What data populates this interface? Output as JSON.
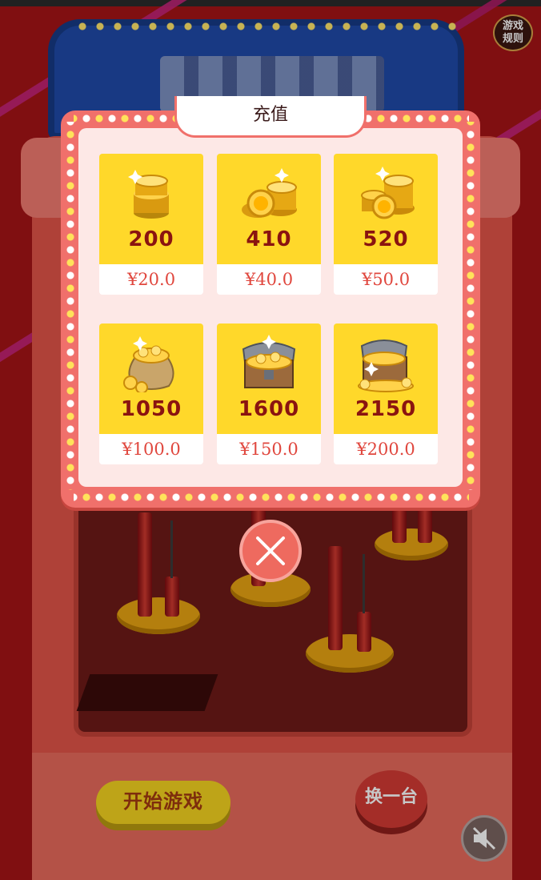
{
  "modal": {
    "title": "充值",
    "packages": [
      {
        "amount": "200",
        "price": "¥20.0",
        "icon": "coin-stack-small-icon"
      },
      {
        "amount": "410",
        "price": "¥40.0",
        "icon": "coin-stack-medium-icon"
      },
      {
        "amount": "520",
        "price": "¥50.0",
        "icon": "coin-stack-large-icon"
      },
      {
        "amount": "1050",
        "price": "¥100.0",
        "icon": "coin-bag-icon"
      },
      {
        "amount": "1600",
        "price": "¥150.0",
        "icon": "treasure-chest-icon"
      },
      {
        "amount": "2150",
        "price": "¥200.0",
        "icon": "treasure-chest-overflow-icon"
      }
    ],
    "close_icon": "close-icon"
  },
  "game": {
    "rules_label": "游戏规则",
    "start_label": "开始游戏",
    "swap_label": "换一台",
    "mute_icon": "sound-off-icon"
  },
  "colors": {
    "background": "#a51416",
    "modal_border": "#f0706b",
    "card_yellow": "#ffd82a",
    "amount_text": "#8a1410",
    "price_text": "#e0473e"
  }
}
